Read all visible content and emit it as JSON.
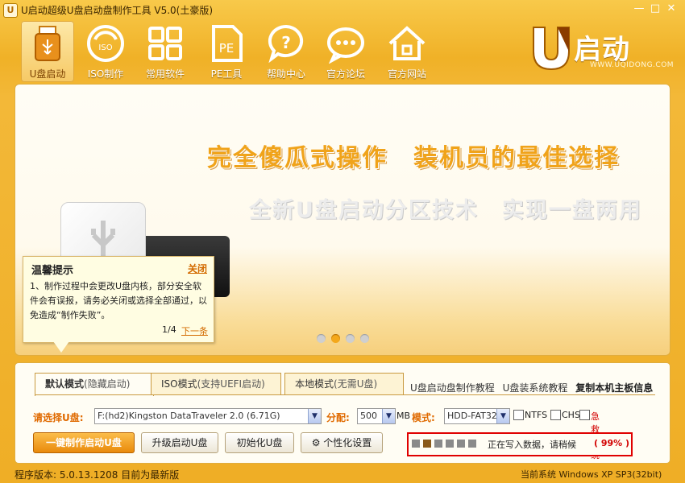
{
  "window": {
    "title": "U启动超级U盘启动盘制作工具 V5.0(土豪版)",
    "icon": "u-logo-icon",
    "controls": {
      "minimize": "—",
      "maximize": "□",
      "close": "✕"
    }
  },
  "toolbar": {
    "items": [
      {
        "label": "U盘启动",
        "icon": "usb-drive-icon",
        "active": true
      },
      {
        "label": "ISO制作",
        "icon": "iso-disc-icon",
        "active": false
      },
      {
        "label": "常用软件",
        "icon": "grid-apps-icon",
        "active": false
      },
      {
        "label": "PE工具",
        "icon": "pe-document-icon",
        "active": false
      },
      {
        "label": "帮助中心",
        "icon": "help-question-icon",
        "active": false
      },
      {
        "label": "官方论坛",
        "icon": "chat-bubble-icon",
        "active": false
      },
      {
        "label": "官方网站",
        "icon": "home-icon",
        "active": false
      }
    ]
  },
  "logo": {
    "text": "启动",
    "url": "WWW.UQIDONG.COM"
  },
  "banner": {
    "headline": "完全傻瓜式操作　装机员的最佳选择",
    "subline": "全新U盘启动分区技术　实现一盘两用",
    "slides_total": 4,
    "slide_active": 2
  },
  "tip": {
    "title": "温馨提示",
    "close": "关闭",
    "body": "1、制作过程中会更改U盘内核，部分安全软件会有误报，请务必关闭或选择全部通过，以免造成“制作失败”。",
    "page": "1/4",
    "next": "下一条"
  },
  "tabs": [
    {
      "label": "默认模式",
      "hint": "(隐藏启动)",
      "active": true
    },
    {
      "label": "ISO模式",
      "hint": "(支持UEFI启动)",
      "active": false
    },
    {
      "label": "本地模式",
      "hint": "(无需U盘)",
      "active": false
    }
  ],
  "links": {
    "tutorial": "U盘启动盘制作教程",
    "install": "U盘装系统教程",
    "copy_info": "复制本机主板信息"
  },
  "form": {
    "disk_label": "请选择U盘:",
    "disk_value": "F:(hd2)Kingston DataTraveler 2.0 (6.71G)",
    "alloc_label": "分配:",
    "alloc_value": "500",
    "alloc_unit": "MB",
    "mode_label": "模式:",
    "mode_value": "HDD-FAT32",
    "ntfs": "NTFS",
    "chs": "CHS",
    "rescue": "急救系统",
    "ntfs_checked": false,
    "chs_checked": false,
    "rescue_checked": false
  },
  "actions": {
    "make": "一键制作启动U盘",
    "upgrade": "升级启动U盘",
    "init": "初始化U盘",
    "personalize": "个性化设置"
  },
  "progress": {
    "text": "正在写入数据，请稍候",
    "percent": "( 99% )",
    "blocks_total": 7,
    "blocks_done": 2
  },
  "status": {
    "version": "程序版本: 5.0.13.1208 目前为最新版",
    "system": "当前系统 Windows XP SP3(32bit)"
  },
  "colors": {
    "accent": "#f0b127",
    "highlight_red": "#e00000",
    "label_orange": "#e06a00"
  }
}
